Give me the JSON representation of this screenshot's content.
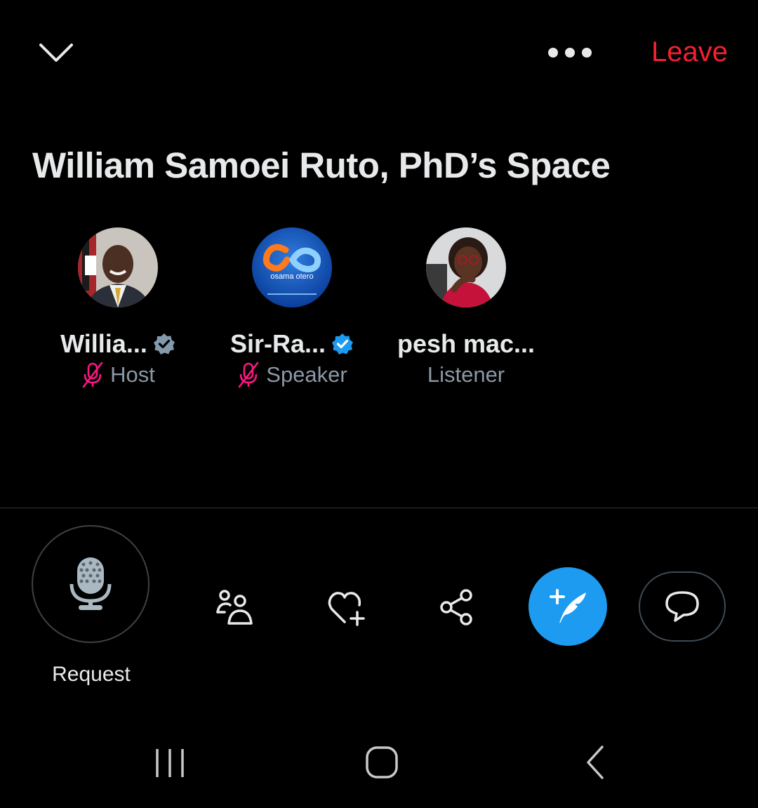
{
  "header": {
    "collapse_icon": "chevron-down-icon",
    "more_icon": "more-horizontal-icon",
    "leave_label": "Leave",
    "leave_color": "#f4212e"
  },
  "space": {
    "title": "William Samoei Ruto, PhD’s Space"
  },
  "participants": [
    {
      "name": "Willia...",
      "role": "Host",
      "verified": true,
      "verified_color": "#829aab",
      "muted": true
    },
    {
      "name": "Sir-Ra...",
      "role": "Speaker",
      "verified": true,
      "verified_color": "#1d9bf0",
      "muted": true,
      "avatar_text": "osama otero"
    },
    {
      "name": "pesh mac...",
      "role": "Listener",
      "verified": false,
      "muted": false
    }
  ],
  "controls": {
    "request_label": "Request",
    "request_icon": "microphone-icon",
    "people_icon": "people-icon",
    "heart_icon": "heart-plus-icon",
    "share_icon": "share-icon",
    "compose_icon": "compose-quill-icon",
    "comment_icon": "comment-bubble-icon",
    "accent_color": "#1d9bf0"
  },
  "nav": {
    "recents_icon": "recents-icon",
    "home_icon": "home-icon",
    "back_icon": "back-icon"
  }
}
